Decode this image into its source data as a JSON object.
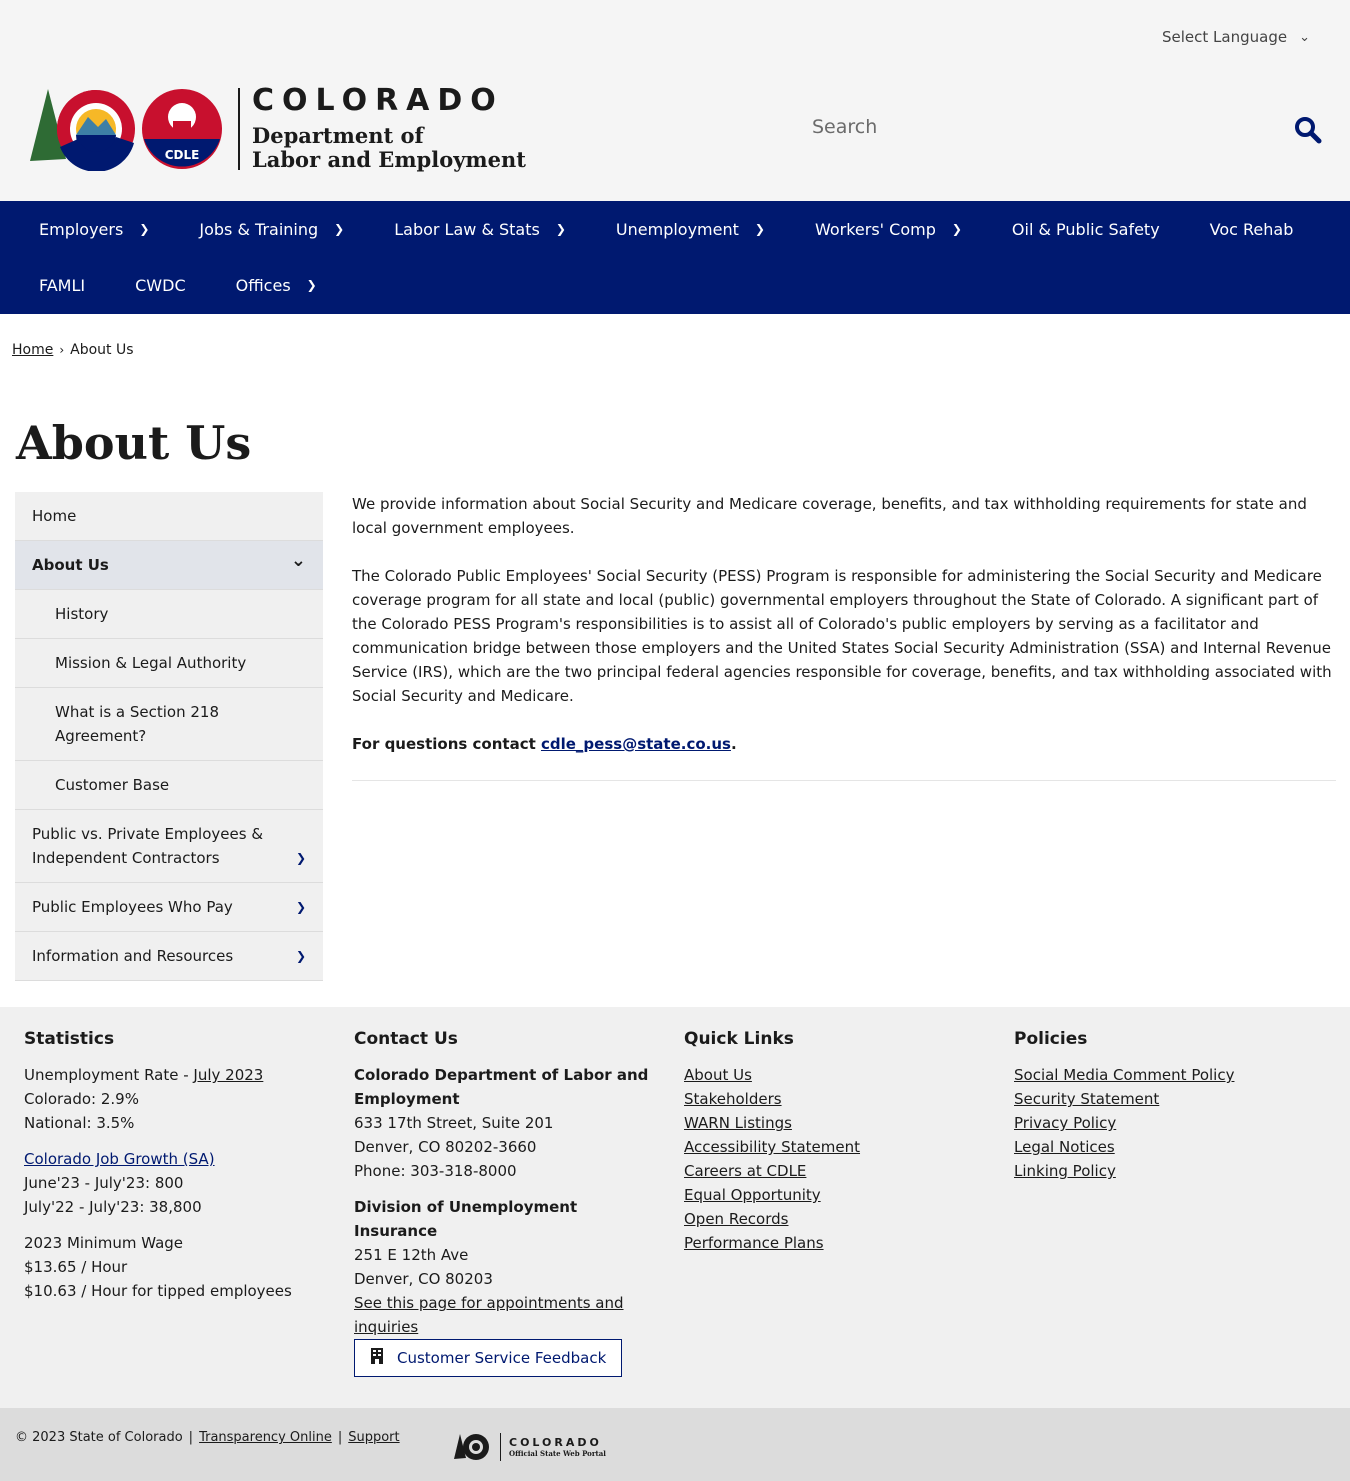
{
  "top": {
    "language": "Select Language"
  },
  "header": {
    "logo_seal": "CDLE",
    "logo_state": "COLORADO",
    "logo_dept_line1": "Department of",
    "logo_dept_line2": "Labor and Employment",
    "search_placeholder": "Search"
  },
  "nav": [
    {
      "label": "Employers",
      "chevron": true
    },
    {
      "label": "Jobs & Training",
      "chevron": true
    },
    {
      "label": "Labor Law & Stats",
      "chevron": true
    },
    {
      "label": "Unemployment",
      "chevron": true
    },
    {
      "label": "Workers' Comp",
      "chevron": true
    },
    {
      "label": "Oil & Public Safety",
      "chevron": false
    },
    {
      "label": "Voc Rehab",
      "chevron": false
    },
    {
      "label": "FAMLI",
      "chevron": false
    },
    {
      "label": "CWDC",
      "chevron": false
    },
    {
      "label": "Offices",
      "chevron": true
    }
  ],
  "breadcrumb": {
    "home": "Home",
    "current": "About Us"
  },
  "page_title": "About Us",
  "sidenav": [
    {
      "label": "Home",
      "level": 1,
      "state": "none"
    },
    {
      "label": "About Us",
      "level": 1,
      "state": "expanded"
    },
    {
      "label": "History",
      "level": 2,
      "state": "none"
    },
    {
      "label": "Mission & Legal Authority",
      "level": 2,
      "state": "none"
    },
    {
      "label": "What is a Section 218 Agreement?",
      "level": 2,
      "state": "none"
    },
    {
      "label": "Customer Base",
      "level": 2,
      "state": "none"
    },
    {
      "label": "Public vs. Private Employees & Independent Contractors",
      "level": 1,
      "state": "collapsed"
    },
    {
      "label": "Public Employees Who Pay",
      "level": 1,
      "state": "collapsed"
    },
    {
      "label": "Information and Resources",
      "level": 1,
      "state": "collapsed"
    }
  ],
  "main": {
    "p1": "We provide information about Social Security and Medicare coverage, benefits, and tax withholding requirements for state and local government employees.",
    "p2": "The Colorado Public Employees' Social Security (PESS) Program is responsible for administering the Social Security and Medicare coverage program for all state and local (public) governmental employers throughout the State of Colorado. A significant part of the Colorado PESS Program's responsibilities is to assist all of Colorado's public employers by serving as a facilitator and communication bridge between those employers and the United States Social Security Administration (SSA) and Internal Revenue Service (IRS), which are the two principal federal agencies responsible for coverage, benefits, and tax withholding associated with Social Security and Medicare.",
    "contact_prefix": "For questions contact ",
    "contact_email": "cdle_pess@state.co.us",
    "contact_suffix": "."
  },
  "footer": {
    "stats": {
      "title": "Statistics",
      "unemp_label": "Unemployment Rate - ",
      "unemp_link": "July 2023",
      "colorado": "Colorado: 2.9%",
      "national": "National: 3.5%",
      "job_growth_link": "Colorado Job Growth (SA)",
      "jg1": "June'23 - July'23: 800",
      "jg2": "July'22 - July'23: 38,800",
      "min_wage_title": "2023 Minimum Wage",
      "min_wage": "$13.65 / Hour",
      "min_wage_tipped": "$10.63 / Hour for tipped employees"
    },
    "contact": {
      "title": "Contact Us",
      "org": "Colorado Department of Labor and Employment",
      "addr1": "633 17th Street, Suite 201",
      "addr2": "Denver, CO  80202-3660",
      "phone": "Phone: 303-318-8000",
      "ui_title": "Division of Unemployment Insurance",
      "ui_addr1": "251 E 12th Ave",
      "ui_addr2": "Denver, CO  80203",
      "ui_link": "See this page for appointments and inquiries",
      "feedback_label": "Customer Service Feedback"
    },
    "quick_links": {
      "title": "Quick Links",
      "items": [
        "About Us",
        "Stakeholders",
        "WARN Listings",
        "Accessibility Statement",
        "Careers at CDLE",
        "Equal Opportunity",
        "Open Records",
        "Performance Plans"
      ]
    },
    "policies": {
      "title": "Policies",
      "items": [
        "Social Media Comment Policy",
        "Security Statement",
        "Privacy Policy",
        "Legal Notices",
        "Linking Policy"
      ]
    }
  },
  "bottom": {
    "copyright": "© 2023 State of Colorado",
    "transparency": "Transparency Online",
    "support": "Support",
    "portal_state": "COLORADO",
    "portal_sub": "Official State Web Portal"
  },
  "colors": {
    "nav_bg": "#001970",
    "link_blue": "#001970",
    "accent_red": "#c8102e"
  }
}
